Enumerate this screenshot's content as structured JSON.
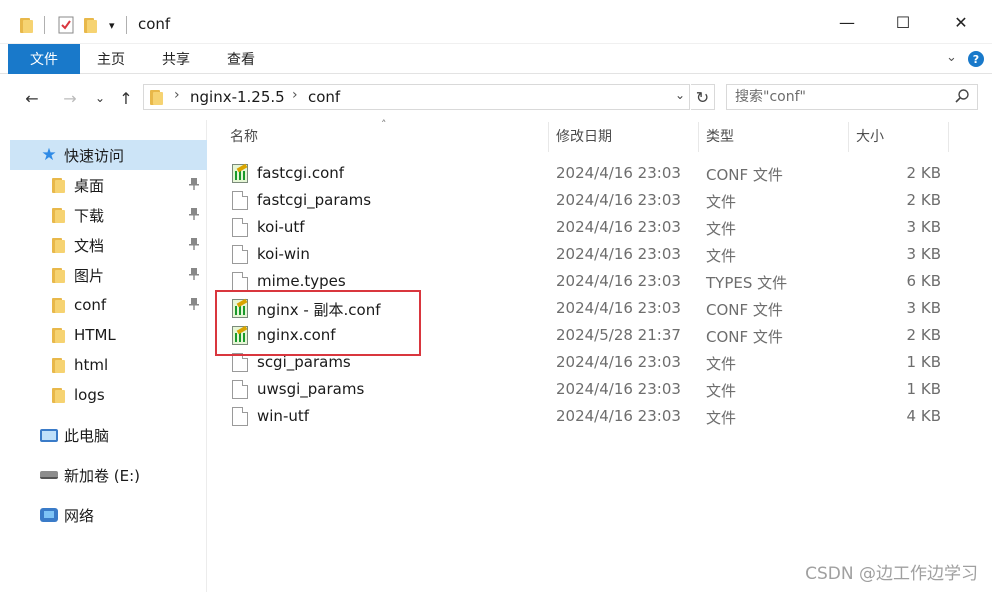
{
  "window": {
    "title": "conf",
    "quick_access_dropdown": "▾",
    "controls": {
      "minimize": "—",
      "maximize": "☐",
      "close": "✕"
    }
  },
  "ribbon": {
    "tabs": [
      {
        "label": "文件",
        "active": true
      },
      {
        "label": "主页",
        "active": false
      },
      {
        "label": "共享",
        "active": false
      },
      {
        "label": "查看",
        "active": false
      }
    ],
    "expand_icon": "chevron-down-icon",
    "help_icon": "help-icon"
  },
  "navigation": {
    "back_icon": "←",
    "forward_icon": "→",
    "recent_icon": "⌄",
    "up_icon": "↑",
    "breadcrumbs": [
      "nginx-1.25.5",
      "conf"
    ],
    "crumb_separator": "›",
    "address_dropdown": "⌄",
    "refresh_icon": "↻",
    "search_placeholder": "搜索\"conf\"",
    "search_icon": "⚲"
  },
  "sidebar": {
    "quick_access": {
      "label": "快速访问",
      "icon": "star-icon"
    },
    "pinned": [
      {
        "label": "桌面",
        "icon": "folder-icon",
        "pinned": true
      },
      {
        "label": "下载",
        "icon": "folder-icon",
        "pinned": true
      },
      {
        "label": "文档",
        "icon": "folder-icon",
        "pinned": true
      },
      {
        "label": "图片",
        "icon": "folder-icon",
        "pinned": true
      },
      {
        "label": "conf",
        "icon": "folder-icon",
        "pinned": true
      },
      {
        "label": "HTML",
        "icon": "folder-icon",
        "pinned": false
      },
      {
        "label": "html",
        "icon": "folder-icon",
        "pinned": false
      },
      {
        "label": "logs",
        "icon": "folder-icon",
        "pinned": false
      }
    ],
    "this_pc": {
      "label": "此电脑",
      "icon": "computer-icon"
    },
    "drive": {
      "label": "新加卷 (E:)",
      "icon": "drive-icon"
    },
    "network": {
      "label": "网络",
      "icon": "network-icon"
    },
    "pin_glyph": "📌"
  },
  "file_list": {
    "columns": {
      "name": "名称",
      "date": "修改日期",
      "type": "类型",
      "size": "大小"
    },
    "sort_indicator": "˄",
    "files": [
      {
        "name": "fastcgi.conf",
        "date": "2024/4/16 23:03",
        "type": "CONF 文件",
        "size": "2 KB",
        "icon": "conf-file-icon"
      },
      {
        "name": "fastcgi_params",
        "date": "2024/4/16 23:03",
        "type": "文件",
        "size": "2 KB",
        "icon": "file-icon"
      },
      {
        "name": "koi-utf",
        "date": "2024/4/16 23:03",
        "type": "文件",
        "size": "3 KB",
        "icon": "file-icon"
      },
      {
        "name": "koi-win",
        "date": "2024/4/16 23:03",
        "type": "文件",
        "size": "3 KB",
        "icon": "file-icon"
      },
      {
        "name": "mime.types",
        "date": "2024/4/16 23:03",
        "type": "TYPES 文件",
        "size": "6 KB",
        "icon": "file-icon"
      },
      {
        "name": "nginx - 副本.conf",
        "date": "2024/4/16 23:03",
        "type": "CONF 文件",
        "size": "3 KB",
        "icon": "conf-file-icon"
      },
      {
        "name": "nginx.conf",
        "date": "2024/5/28 21:37",
        "type": "CONF 文件",
        "size": "2 KB",
        "icon": "conf-file-icon"
      },
      {
        "name": "scgi_params",
        "date": "2024/4/16 23:03",
        "type": "文件",
        "size": "1 KB",
        "icon": "file-icon"
      },
      {
        "name": "uwsgi_params",
        "date": "2024/4/16 23:03",
        "type": "文件",
        "size": "1 KB",
        "icon": "file-icon"
      },
      {
        "name": "win-utf",
        "date": "2024/4/16 23:03",
        "type": "文件",
        "size": "4 KB",
        "icon": "file-icon"
      }
    ]
  },
  "watermark": "CSDN @边工作边学习",
  "colors": {
    "accent": "#1979ca",
    "selected": "#cce4f7",
    "highlight_box": "#d9363e"
  }
}
